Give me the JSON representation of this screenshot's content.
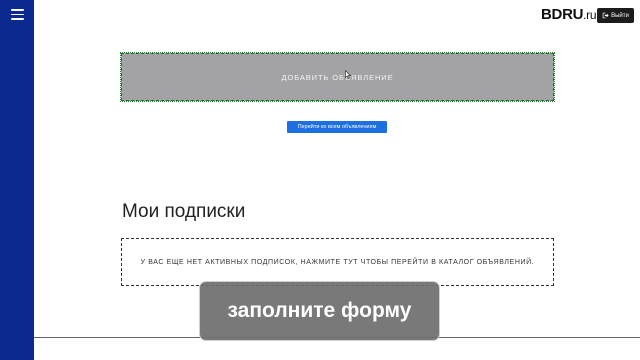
{
  "header": {
    "brand_name": "BDRU",
    "brand_tld": ".ru",
    "logout_label": "Выйти",
    "logout_icon": "sign-out-icon",
    "menu_icon": "hamburger-icon"
  },
  "main": {
    "add_ad_label": "ДОБАВИТЬ ОБЪЯВЛЕНИЕ",
    "all_ads_button": "Перейти ко всем объявлениям",
    "subscriptions_title": "Мои подписки",
    "no_subscriptions_text": "У ВАС ЕЩЕ НЕТ АКТИВНЫХ ПОДПИСОК, НАЖМИТЕ ТУТ ЧТОБЫ ПЕРЕЙТИ В КАТАЛОГ ОБЪЯВЛЕНИЙ."
  },
  "overlay": {
    "caption": "заполните форму"
  },
  "colors": {
    "sidebar": "#0a2a8f",
    "primary_button": "#1e6fe0",
    "add_ad_background": "#a3a3a6"
  }
}
